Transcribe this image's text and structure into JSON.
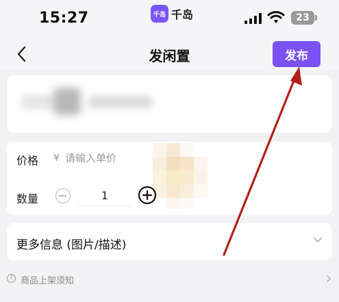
{
  "status_bar": {
    "time": "15:27",
    "app_badge": "千岛",
    "app_name": "千岛",
    "battery": "23"
  },
  "nav": {
    "title": "发闲置",
    "publish_label": "发布"
  },
  "form": {
    "price_label": "价格",
    "currency_symbol": "¥",
    "price_placeholder": "请输入单价",
    "quantity_label": "数量",
    "quantity_value": "1"
  },
  "more_info": {
    "label": "更多信息 (图片/描述)"
  },
  "footer": {
    "notice_label": "商品上架须知"
  },
  "colors": {
    "accent": "#7a52f4",
    "annotation_arrow": "#b0201c",
    "background": "#f2f2f4"
  },
  "icons": [
    "back-chevron-icon",
    "signal-icon",
    "wifi-icon",
    "battery-icon",
    "minus-circle-icon",
    "plus-circle-icon",
    "chevron-down-icon",
    "question-icon",
    "chevron-right-icon"
  ]
}
